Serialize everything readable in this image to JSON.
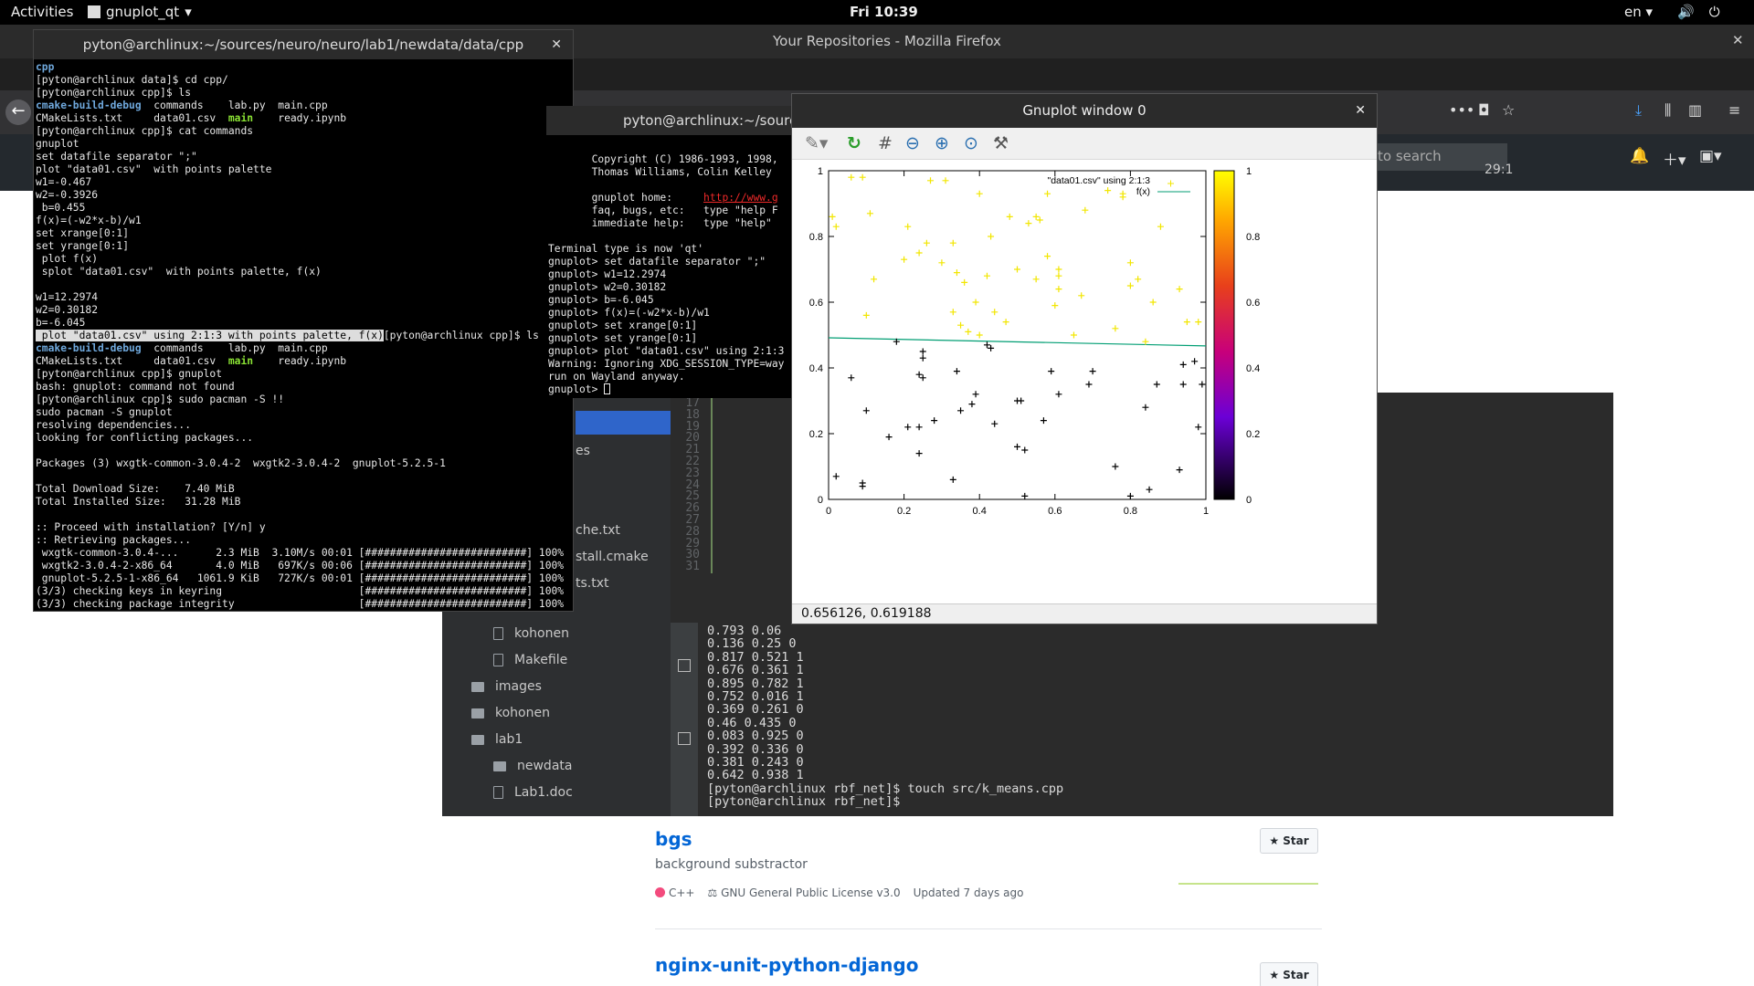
{
  "topbar": {
    "activities": "Activities",
    "app": "gnuplot_qt",
    "clock": "Fri 10:39",
    "lang": "en"
  },
  "firefox": {
    "title": "Your Repositories - Mozilla Firefox",
    "search_placeholder": "to search"
  },
  "repos": [
    {
      "name": "bgs",
      "desc": "background substractor",
      "lang": "C++",
      "license": "GNU General Public License v3.0",
      "updated": "Updated 7 days ago",
      "star": "Star"
    },
    {
      "name": "nginx-unit-python-django",
      "star": "Star"
    }
  ],
  "ide": {
    "tree": [
      "es",
      "che.txt",
      "stall.cmake",
      "ts.txt",
      "kohonen",
      "Makefile",
      "images",
      "kohonen",
      "lab1",
      "newdata",
      "Lab1.doc"
    ],
    "line_numbers": [
      "17",
      "18",
      "19",
      "20",
      "21",
      "22",
      "23",
      "24",
      "25",
      "26",
      "27",
      "28",
      "29",
      "30",
      "31"
    ],
    "tab_hint": "29:1",
    "console": "0.793 0.06\n0.136 0.25 0\n0.817 0.521 1\n0.676 0.361 1\n0.895 0.782 1\n0.752 0.016 1\n0.369 0.261 0\n0.46 0.435 0\n0.083 0.925 0\n0.392 0.336 0\n0.381 0.243 0\n0.642 0.938 1\n[pyton@archlinux rbf_net]$ touch src/k_means.cpp\n[pyton@archlinux rbf_net]$ "
  },
  "term1": {
    "title": "pyton@archlinux:~/sources/neuro/neuro/lab1/newdata/data/cpp",
    "lines_a": "[pyton@archlinux data]$ cd cpp/\n[pyton@archlinux cpp]$ ls",
    "ls1_a": "cmake-build-debug",
    "ls1_b": "  commands    lab.py  main.cpp\nCMakeLists.txt     data01.csv  ",
    "ls1_main": "main",
    "ls1_c": "    ready.ipynb",
    "lines_b": "[pyton@archlinux cpp]$ cat commands\ngnuplot\nset datafile separator \";\"\nplot \"data01.csv\"  with points palette\nw1=-0.467\nw2=-0.3926\n b=0.455\nf(x)=(-w2*x-b)/w1\nset xrange[0:1]\nset yrange[0:1]\n plot f(x)\n splot \"data01.csv\"  with points palette, f(x)\n\nw1=12.2974\nw2=0.30182\nb=-6.045",
    "highlight": " plot \"data01.csv\" using 2:1:3 with points palette, f(x)",
    "after_hl": "[pyton@archlinux cpp]$ ls",
    "lines_c": "[pyton@archlinux cpp]$ gnuplot\nbash: gnuplot: command not found\n[pyton@archlinux cpp]$ sudo pacman -S !!\nsudo pacman -S gnuplot\nresolving dependencies...\nlooking for conflicting packages...\n\nPackages (3) wxgtk-common-3.0.4-2  wxgtk2-3.0.4-2  gnuplot-5.2.5-1\n\nTotal Download Size:    7.40 MiB\nTotal Installed Size:   31.28 MiB\n\n:: Proceed with installation? [Y/n] y\n:: Retrieving packages...\n wxgtk-common-3.0.4-...      2.3 MiB  3.10M/s 00:01 [##########################] 100%\n wxgtk2-3.0.4-2-x86_64       4.0 MiB   697K/s 00:06 [##########################] 100%\n gnuplot-5.2.5-1-x86_64   1061.9 KiB   727K/s 00:01 [##########################] 100%\n(3/3) checking keys in keyring                      [##########################] 100%\n(3/3) checking package integrity                    [##########################] 100%"
  },
  "term2": {
    "title": "pyton@archlinux:~/sources/",
    "lines_a": "       Copyright (C) 1986-1993, 1998,\n       Thomas Williams, Colin Kelley\n\n       gnuplot home:     ",
    "link": "http://www.g",
    "lines_b": "\n       faq, bugs, etc:   type \"help F\n       immediate help:   type \"help\"\n\nTerminal type is now 'qt'\ngnuplot> set datafile separator \";\"\ngnuplot> w1=12.2974\ngnuplot> w2=0.30182\ngnuplot> b=-6.045\ngnuplot> f(x)=(-w2*x-b)/w1\ngnuplot> set xrange[0:1]\ngnuplot> set yrange[0:1]\ngnuplot> plot \"data01.csv\" using 2:1:3\nWarning: Ignoring XDG_SESSION_TYPE=way\nrun on Wayland anyway.\ngnuplot> "
  },
  "gnuplot": {
    "title": "Gnuplot window 0",
    "status": "0.656126,  0.619188"
  },
  "chart_data": {
    "type": "scatter",
    "xlim": [
      0,
      1
    ],
    "ylim": [
      0,
      1
    ],
    "x_ticks": [
      "0",
      "0.2",
      "0.4",
      "0.6",
      "0.8",
      "1"
    ],
    "y_ticks": [
      "0",
      "0.2",
      "0.4",
      "0.6",
      "0.8",
      "1"
    ],
    "colorbar_ticks": [
      "0",
      "0.2",
      "0.4",
      "0.6",
      "0.8",
      "1"
    ],
    "legend": [
      "\"data01.csv\" using 2:1:3",
      "f(x)"
    ],
    "line": {
      "w1": 12.2974,
      "w2": 0.30182,
      "b": -6.045
    },
    "class1": [
      [
        0.01,
        0.86
      ],
      [
        0.02,
        0.83
      ],
      [
        0.06,
        0.98
      ],
      [
        0.09,
        0.98
      ],
      [
        0.11,
        0.87
      ],
      [
        0.12,
        0.67
      ],
      [
        0.1,
        0.56
      ],
      [
        0.21,
        0.83
      ],
      [
        0.2,
        0.73
      ],
      [
        0.24,
        0.75
      ],
      [
        0.26,
        0.78
      ],
      [
        0.27,
        0.97
      ],
      [
        0.31,
        0.97
      ],
      [
        0.3,
        0.72
      ],
      [
        0.33,
        0.78
      ],
      [
        0.33,
        0.57
      ],
      [
        0.34,
        0.69
      ],
      [
        0.36,
        0.66
      ],
      [
        0.35,
        0.53
      ],
      [
        0.37,
        0.51
      ],
      [
        0.39,
        0.6
      ],
      [
        0.4,
        0.5
      ],
      [
        0.4,
        0.93
      ],
      [
        0.42,
        0.68
      ],
      [
        0.43,
        0.8
      ],
      [
        0.44,
        0.57
      ],
      [
        0.47,
        0.54
      ],
      [
        0.48,
        0.86
      ],
      [
        0.5,
        0.7
      ],
      [
        0.53,
        0.84
      ],
      [
        0.55,
        0.67
      ],
      [
        0.55,
        0.86
      ],
      [
        0.56,
        0.85
      ],
      [
        0.58,
        0.74
      ],
      [
        0.58,
        0.93
      ],
      [
        0.6,
        0.59
      ],
      [
        0.61,
        0.64
      ],
      [
        0.61,
        0.68
      ],
      [
        0.61,
        0.7
      ],
      [
        0.65,
        0.5
      ],
      [
        0.67,
        0.62
      ],
      [
        0.68,
        0.88
      ],
      [
        0.74,
        0.94
      ],
      [
        0.76,
        0.52
      ],
      [
        0.78,
        0.93
      ],
      [
        0.78,
        0.92
      ],
      [
        0.8,
        0.72
      ],
      [
        0.8,
        0.65
      ],
      [
        0.82,
        0.67
      ],
      [
        0.84,
        0.48
      ],
      [
        0.86,
        0.6
      ],
      [
        0.88,
        0.83
      ],
      [
        0.93,
        0.64
      ],
      [
        0.95,
        0.54
      ],
      [
        0.98,
        0.54
      ]
    ],
    "class0": [
      [
        0.02,
        0.07
      ],
      [
        0.06,
        0.37
      ],
      [
        0.09,
        0.05
      ],
      [
        0.09,
        0.04
      ],
      [
        0.1,
        0.27
      ],
      [
        0.16,
        0.19
      ],
      [
        0.18,
        0.48
      ],
      [
        0.21,
        0.22
      ],
      [
        0.24,
        0.22
      ],
      [
        0.24,
        0.38
      ],
      [
        0.25,
        0.37
      ],
      [
        0.25,
        0.45
      ],
      [
        0.25,
        0.43
      ],
      [
        0.24,
        0.14
      ],
      [
        0.28,
        0.24
      ],
      [
        0.33,
        0.06
      ],
      [
        0.34,
        0.39
      ],
      [
        0.35,
        0.27
      ],
      [
        0.38,
        0.29
      ],
      [
        0.39,
        0.32
      ],
      [
        0.42,
        0.47
      ],
      [
        0.43,
        0.46
      ],
      [
        0.44,
        0.23
      ],
      [
        0.5,
        0.16
      ],
      [
        0.5,
        0.3
      ],
      [
        0.51,
        0.3
      ],
      [
        0.52,
        0.15
      ],
      [
        0.52,
        0.01
      ],
      [
        0.57,
        0.24
      ],
      [
        0.59,
        0.39
      ],
      [
        0.61,
        0.32
      ],
      [
        0.69,
        0.35
      ],
      [
        0.7,
        0.39
      ],
      [
        0.76,
        0.1
      ],
      [
        0.8,
        0.01
      ],
      [
        0.84,
        0.28
      ],
      [
        0.85,
        0.03
      ],
      [
        0.87,
        0.35
      ],
      [
        0.93,
        0.09
      ],
      [
        0.94,
        0.35
      ],
      [
        0.94,
        0.41
      ],
      [
        0.97,
        0.42
      ],
      [
        0.98,
        0.22
      ],
      [
        0.99,
        0.35
      ]
    ]
  }
}
